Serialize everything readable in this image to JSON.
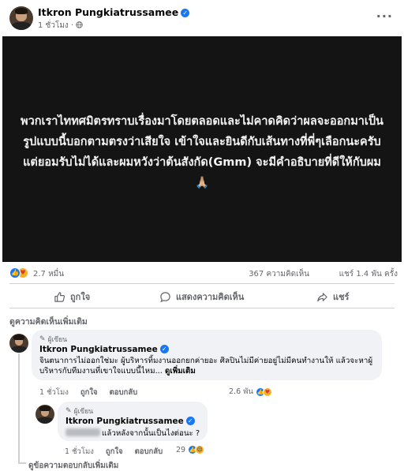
{
  "post": {
    "author": "Itkron Pungkiatrussamee",
    "time": "1 ชั่วโมง",
    "privacy_icon": "globe-icon",
    "more_icon": "ellipsis-icon",
    "media_text": "พวกเราไททศมิตรทราบเรื่องมาโดยตลอดและไม่คาดคิดว่าผลจะออกมาเป็นรูปแบบนี้บอกตามตรงว่าเสียใจ เข้าใจและยินดีกับเส้นทางที่พี่ๆเลือกนะครับ แต่ยอมรับไม่ได้และผมหวังว่าต้นสังกัด(Gmm) จะมีคำอธิบายที่ดีให้กับผม 🙏🏼",
    "media_bg_color": "#141414"
  },
  "stats": {
    "reactions": "2.7 หมื่น",
    "comments": "367 ความคิดเห็น",
    "shares": "แชร์ 1.4 พัน ครั้ง"
  },
  "actions": {
    "like": "ถูกใจ",
    "comment": "แสดงความคิดเห็น",
    "share": "แชร์"
  },
  "comments_section": {
    "more_comments": "ดูความคิดเห็นเพิ่มเติม",
    "more_replies": "ดูข้อความตอบกลับเพิ่มเติม"
  },
  "comment1": {
    "badge": "ผู้เขียน",
    "author": "Itkron Pungkiatrussamee",
    "text": "จินตนาการไม่ออกใช่มะ ผู้บริหารทิ้มงานออกยกค่ายอะ ศิลปินไม่มีค่ายอยู่ไม่มีคนทำงานให้ แล้วจะหาผู้บริหารกับทีมงานที่เขาใจแบบนี้ไหม... ",
    "see_more": "ดูเพิ่มเติม",
    "time": "1 ชั่วโมง",
    "like": "ถูกใจ",
    "reply": "ตอบกลับ",
    "reactions": "2.6 พัน"
  },
  "comment2": {
    "badge": "ผู้เขียน",
    "author": "Itkron Pungkiatrussamee",
    "text": "แล้วหลังจากนั้นเป็นไงต่อนะ ?",
    "time": "1 ชั่วโมง",
    "like": "ถูกใจ",
    "reply": "ตอบกลับ",
    "reactions": "29"
  },
  "colors": {
    "brand_blue": "#1877f2",
    "muted_text": "#65676b",
    "bubble_bg": "#f0f2f5"
  }
}
